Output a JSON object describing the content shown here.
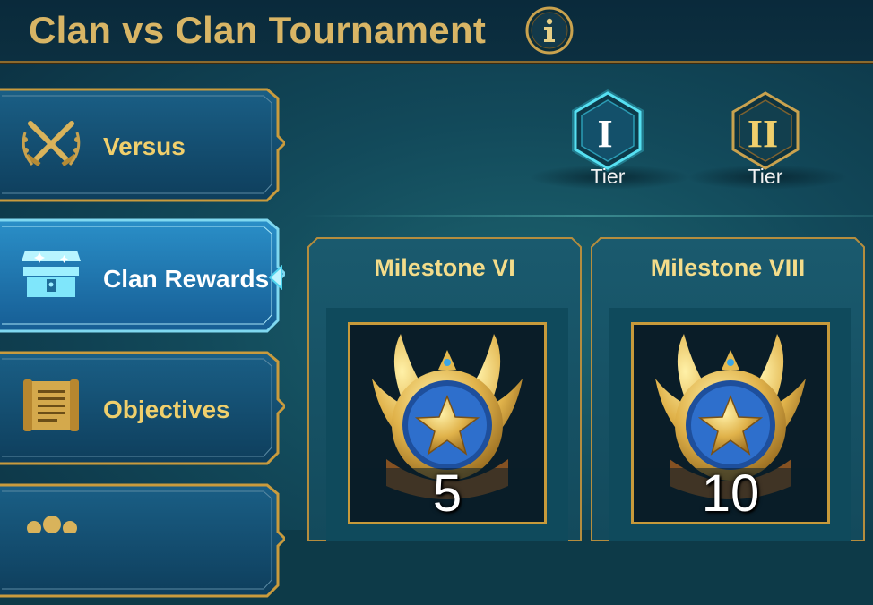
{
  "header": {
    "title": "Clan vs Clan Tournament",
    "info_icon": "info-icon"
  },
  "sidebar": {
    "items": [
      {
        "label": "Versus",
        "icon": "crossed-swords-icon",
        "active": false
      },
      {
        "label": "Clan Rewards",
        "icon": "treasure-chest-icon",
        "active": true
      },
      {
        "label": "Objectives",
        "icon": "scroll-icon",
        "active": false
      },
      {
        "label": "",
        "icon": "helmet-icon",
        "active": false
      }
    ]
  },
  "tiers": [
    {
      "numeral": "I",
      "label": "Tier",
      "selected": true
    },
    {
      "numeral": "II",
      "label": "Tier",
      "selected": false
    }
  ],
  "milestones": [
    {
      "title": "Milestone VI",
      "reward_icon": "winged-star-medal-icon",
      "count": "5"
    },
    {
      "title": "Milestone VIII",
      "reward_icon": "winged-star-medal-icon",
      "count": "10"
    }
  ],
  "colors": {
    "gold": "#d8b565",
    "accent_cyan": "#3ad6e6",
    "panel": "#0f4a5c"
  }
}
